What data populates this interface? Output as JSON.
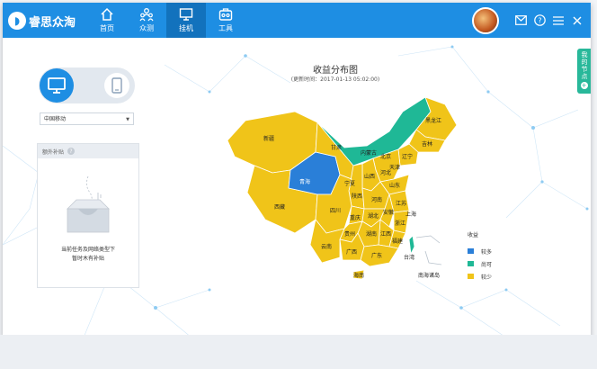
{
  "app": {
    "logo_text": "睿思众淘"
  },
  "nav": {
    "items": [
      {
        "label": "首页",
        "icon": "home-icon"
      },
      {
        "label": "众测",
        "icon": "users-icon"
      },
      {
        "label": "挂机",
        "icon": "monitor-icon"
      },
      {
        "label": "工具",
        "icon": "toolbox-icon"
      }
    ],
    "active": "挂机"
  },
  "window_controls": {
    "icons": [
      "mail-icon",
      "help-icon",
      "menu-icon",
      "close-icon"
    ]
  },
  "device_toggle": {
    "selected": "pc",
    "options": [
      "pc",
      "mobile"
    ]
  },
  "carrier_select": {
    "value": "中国移动"
  },
  "bonus_panel": {
    "title": "额外补贴",
    "help": "?",
    "empty_line1": "当前任务及网络类型下",
    "empty_line2": "暂时木有补贴"
  },
  "side_tab": {
    "label": "我的节点",
    "plus": "+"
  },
  "map": {
    "title": "收益分布图",
    "subtitle": "(更新时间：2017-01-13 05:02:00)",
    "legend_title": "收益",
    "legend": [
      {
        "label": "较多",
        "color": "#2a7fd8"
      },
      {
        "label": "尚可",
        "color": "#1fb896"
      },
      {
        "label": "较少",
        "color": "#f0c419"
      }
    ],
    "regions": {
      "xinjiang": "新疆",
      "xizang": "西藏",
      "qinghai": "青海",
      "gansu": "甘肃",
      "neimenggu": "内蒙古",
      "heilongjiang": "黑龙江",
      "jilin": "吉林",
      "liaoning": "辽宁",
      "beijing": "北京",
      "tianjin": "天津",
      "hebei": "河北",
      "shanxi": "山西",
      "shandong": "山东",
      "ningxia": "宁夏",
      "shaanxi": "陕西",
      "henan": "河南",
      "jiangsu": "江苏",
      "anhui": "安徽",
      "shanghai": "上海",
      "sichuan": "四川",
      "chongqing": "重庆",
      "hubei": "湖北",
      "zhejiang": "浙江",
      "jiangxi": "江西",
      "hunan": "湖南",
      "guizhou": "贵州",
      "fujian": "福建",
      "yunnan": "云南",
      "guangxi": "广西",
      "guangdong": "广东",
      "taiwan": "台湾",
      "hainan": "海南",
      "nanhai": "南海诸岛"
    }
  }
}
